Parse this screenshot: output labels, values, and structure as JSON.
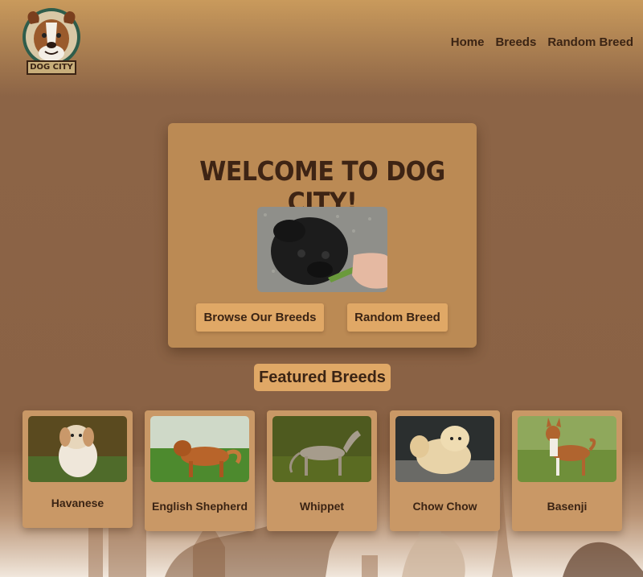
{
  "logo": {
    "text": "DOG CITY"
  },
  "nav": {
    "items": [
      "Home",
      "Breeds",
      "Random Breed"
    ]
  },
  "hero": {
    "title": "WELCOME TO DOG CITY!",
    "browse_label": "Browse Our Breeds",
    "random_label": "Random Breed"
  },
  "featured": {
    "title": "Featured Breeds",
    "breeds": [
      "Havanese",
      "English Shepherd",
      "Whippet",
      "Chow Chow",
      "Basenji"
    ]
  },
  "colors": {
    "accent": "#e0a866",
    "card": "#c99866",
    "text": "#3b2414",
    "hero_panel": "#bb8a54"
  }
}
